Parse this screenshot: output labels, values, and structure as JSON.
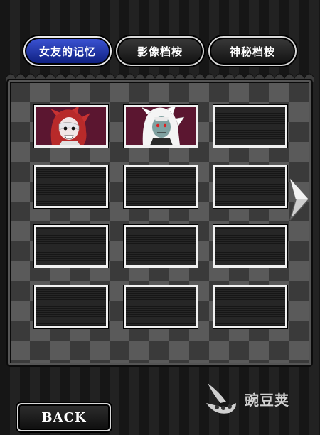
{
  "tabs": [
    {
      "label": "女友的记忆",
      "active": true
    },
    {
      "label": "影像档桉",
      "active": false
    },
    {
      "label": "神秘档桉",
      "active": false
    }
  ],
  "grid": {
    "slots": [
      {
        "unlocked": true,
        "content": "red-haired-character"
      },
      {
        "unlocked": true,
        "content": "white-haired-character"
      },
      {
        "unlocked": false
      },
      {
        "unlocked": false
      },
      {
        "unlocked": false
      },
      {
        "unlocked": false
      },
      {
        "unlocked": false
      },
      {
        "unlocked": false
      },
      {
        "unlocked": false
      },
      {
        "unlocked": false
      },
      {
        "unlocked": false
      },
      {
        "unlocked": false
      }
    ]
  },
  "navigation": {
    "next_icon": "chevron-right-icon"
  },
  "footer": {
    "back_label": "BACK"
  },
  "watermark": {
    "text": "豌豆荚",
    "icon": "wandoujia-logo-icon"
  },
  "colors": {
    "active_tab": "#1c34b4",
    "unlocked_slot_bg": "#5a1530",
    "slot_border": "#f0f0f0"
  }
}
